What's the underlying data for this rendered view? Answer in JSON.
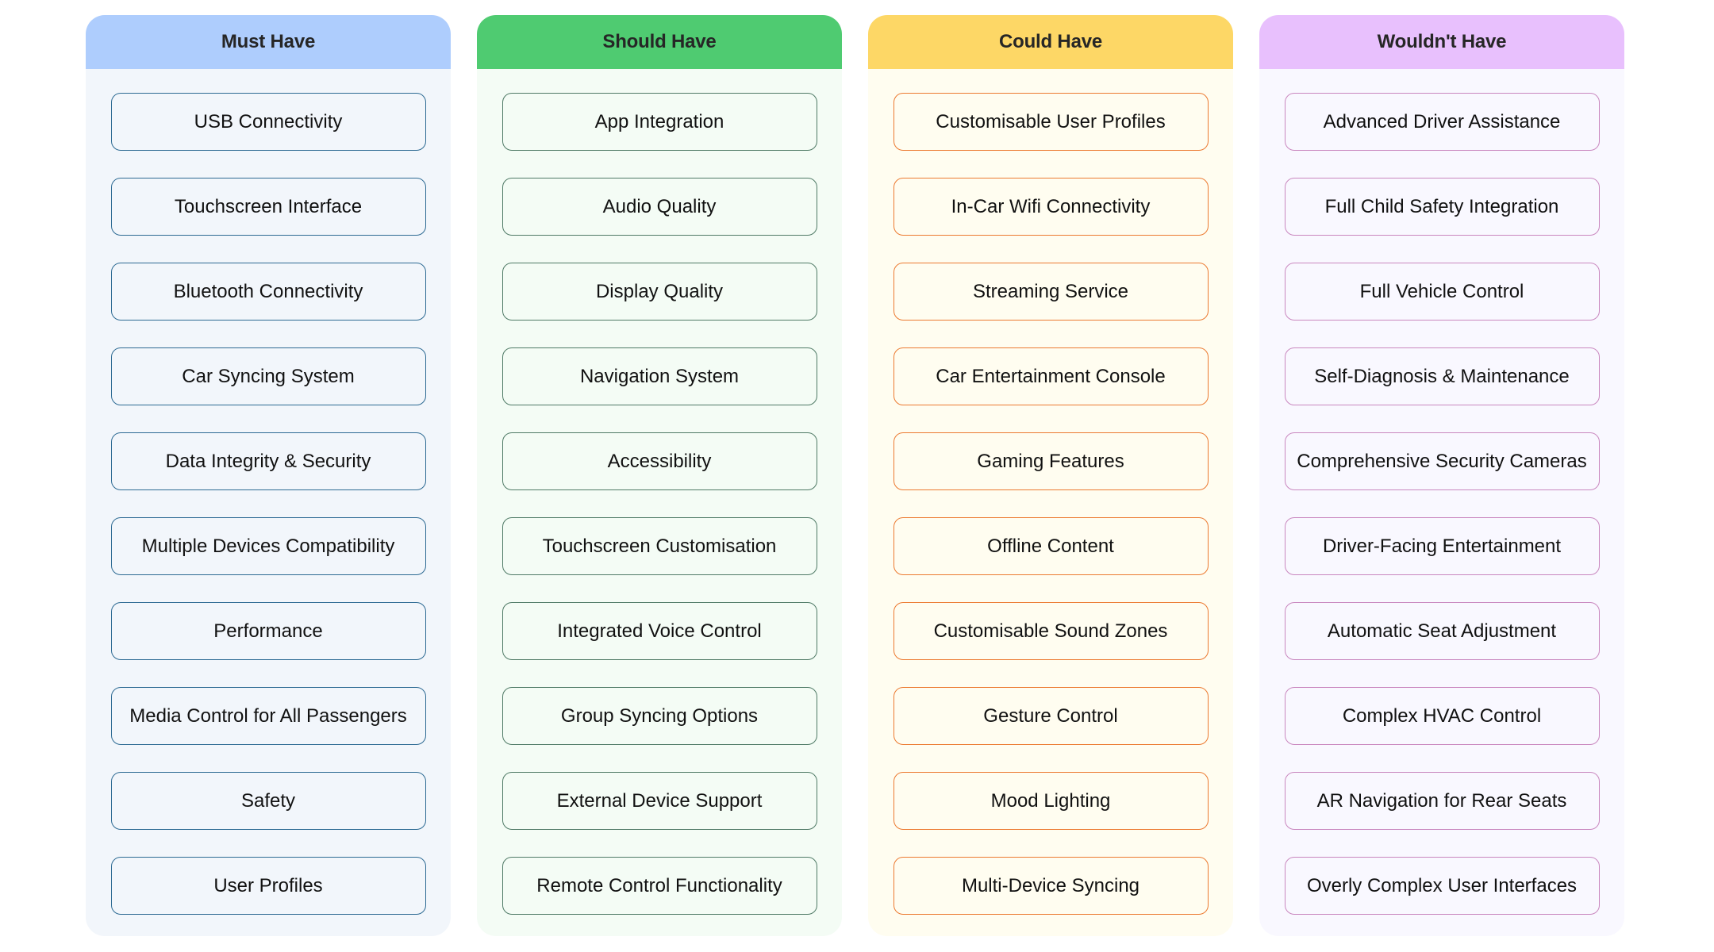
{
  "board": {
    "columns": [
      {
        "key": "must",
        "title": "Must Have",
        "header_color": "#aecdfd",
        "border_color": "#2d6a93",
        "items": [
          "USB Connectivity",
          "Touchscreen Interface",
          "Bluetooth Connectivity",
          "Car Syncing System",
          "Data Integrity & Security",
          "Multiple Devices Compatibility",
          "Performance",
          "Media Control for All Passengers",
          "Safety",
          "User Profiles"
        ]
      },
      {
        "key": "should",
        "title": "Should Have",
        "header_color": "#4fcb71",
        "border_color": "#4f7a66",
        "items": [
          "App Integration",
          "Audio Quality",
          "Display Quality",
          "Navigation System",
          "Accessibility",
          "Touchscreen Customisation",
          "Integrated Voice Control",
          "Group Syncing Options",
          "External Device Support",
          "Remote Control Functionality"
        ]
      },
      {
        "key": "could",
        "title": "Could Have",
        "header_color": "#fdd766",
        "border_color": "#ec7a31",
        "items": [
          "Customisable User Profiles",
          "In-Car Wifi Connectivity",
          "Streaming Service",
          "Car Entertainment Console",
          "Gaming Features",
          "Offline Content",
          "Customisable Sound Zones",
          "Gesture Control",
          "Mood Lighting",
          "Multi-Device Syncing"
        ]
      },
      {
        "key": "wont",
        "title": "Wouldn't Have",
        "header_color": "#e8c0fd",
        "border_color": "#c987bf",
        "items": [
          "Advanced Driver Assistance",
          "Full Child Safety Integration",
          "Full Vehicle Control",
          "Self-Diagnosis & Maintenance",
          "Comprehensive Security Cameras",
          "Driver-Facing Entertainment",
          "Automatic Seat Adjustment",
          "Complex HVAC Control",
          "AR Navigation for Rear Seats",
          "Overly Complex User Interfaces"
        ]
      }
    ]
  }
}
